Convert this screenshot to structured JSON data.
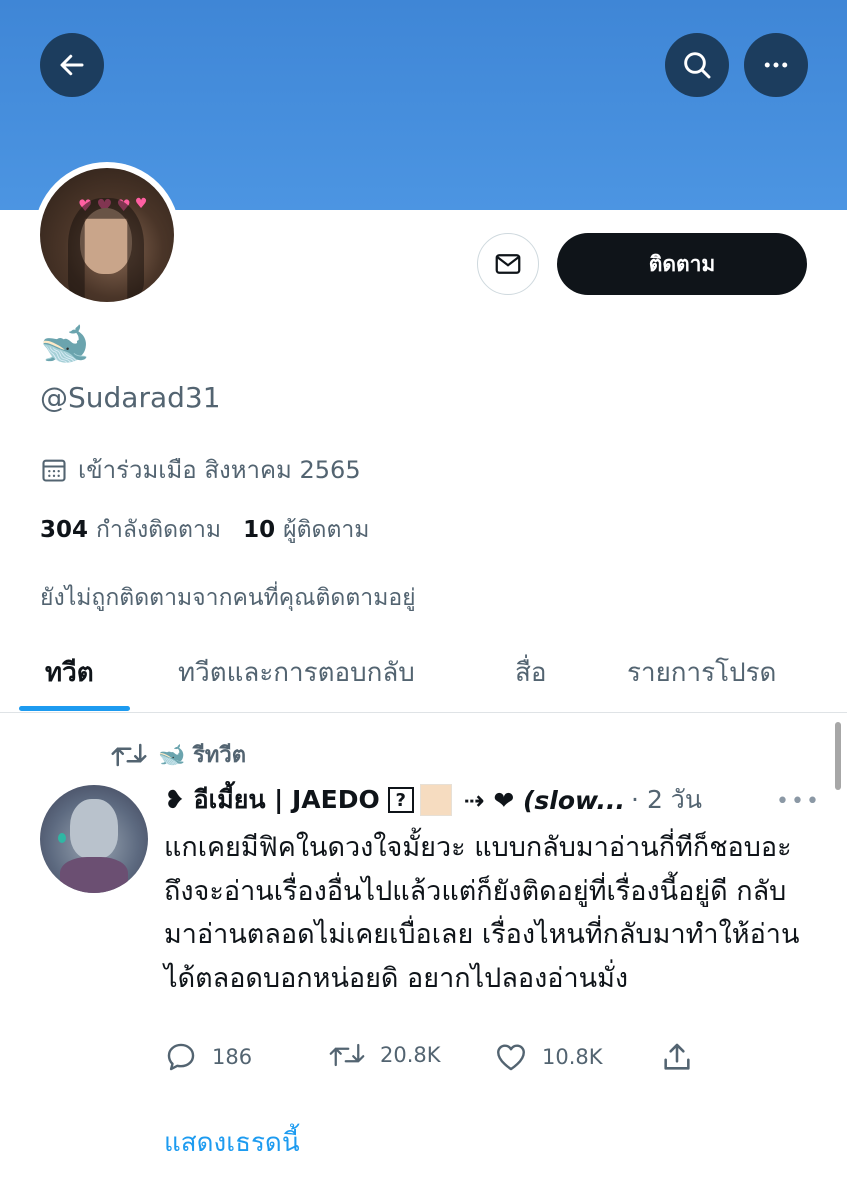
{
  "profile": {
    "display_name": "🐋",
    "handle": "@Sudarad31",
    "joined": "เข้าร่วมเมือ สิงหาคม 2565",
    "following_count": "304",
    "following_label": "กำลังติดตาม",
    "followers_count": "10",
    "followers_label": "ผู้ติดตาม",
    "not_followed_text": "ยังไม่ถูกติดตามจากคนที่คุณติดตามอยู่"
  },
  "actions": {
    "follow_label": "ติดตาม"
  },
  "tabs": [
    {
      "label": "ทวีต",
      "active": true
    },
    {
      "label": "ทวีตและการตอบกลับ",
      "active": false
    },
    {
      "label": "สื่อ",
      "active": false
    },
    {
      "label": "รายการโปรด",
      "active": false
    }
  ],
  "tweet": {
    "retweet_label": "🐋 รีทวีต",
    "author_prefix": "❥ อีเมี้ยน | JAEDO",
    "author_q": "?",
    "author_suffix": "⇢ ❤ (slow...",
    "time": "· 2 วัน",
    "body": "แกเคยมีฟิคในดวงใจมั้ยวะ แบบกลับมาอ่านกี่ทีก็ชอบอะ ถึงจะอ่านเรื่องอื่นไปแล้วแต่ก็ยังติดอยู่ที่เรื่องนี้อยู่ดี กลับมาอ่านตลอดไม่เคยเบื่อเลย เรื่องไหนที่กลับมาทำให้อ่านได้ตลอดบอกหน่อยดิ อยากไปลองอ่านมั่ง",
    "replies": "186",
    "retweets": "20.8K",
    "likes": "10.8K",
    "show_thread": "แสดงเธรดนี้"
  },
  "icons": [
    "back-arrow-icon",
    "search-icon",
    "more-icon",
    "mail-icon",
    "calendar-icon",
    "retweet-icon",
    "reply-icon",
    "like-icon",
    "share-icon"
  ],
  "colors": {
    "banner": "#4a90e0",
    "accent": "#1d9bf0",
    "follow_button": "#0f1419",
    "muted_text": "#536471"
  }
}
